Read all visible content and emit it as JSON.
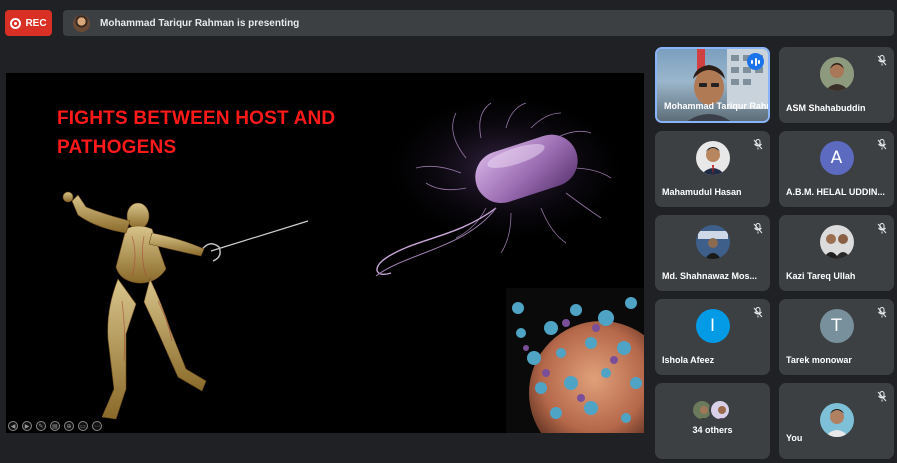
{
  "topbar": {
    "rec_label": "REC",
    "presenting_text": "Mohammad Tariqur Rahman is presenting"
  },
  "slide": {
    "title": "FIGHTS BETWEEN HOST AND PATHOGENS"
  },
  "participants": [
    {
      "name": "Mohammad Tariqur Rahman",
      "speaking": true
    },
    {
      "name": "ASM Shahabuddin",
      "muted": true
    },
    {
      "name": "Mahamudul Hasan",
      "muted": true
    },
    {
      "name": "A.B.M. HELAL UDDIN...",
      "muted": true,
      "initial": "A",
      "color": "#5c6bc0"
    },
    {
      "name": "Md. Shahnawaz Mos...",
      "muted": true
    },
    {
      "name": "Kazi Tareq Ullah",
      "muted": true
    },
    {
      "name": "Ishola Afeez",
      "muted": true,
      "initial": "I",
      "color": "#039be5"
    },
    {
      "name": "Tarek monowar",
      "muted": true,
      "initial": "T",
      "color": "#78909c"
    },
    {
      "name": "34 others"
    },
    {
      "name": "You",
      "muted": true
    }
  ],
  "colors": {
    "rec": "#d93025",
    "title_red": "#ff1a1a",
    "tile_bg": "#3c4043",
    "active_border": "#8ab4f8",
    "speaking_badge": "#1a73e8"
  }
}
